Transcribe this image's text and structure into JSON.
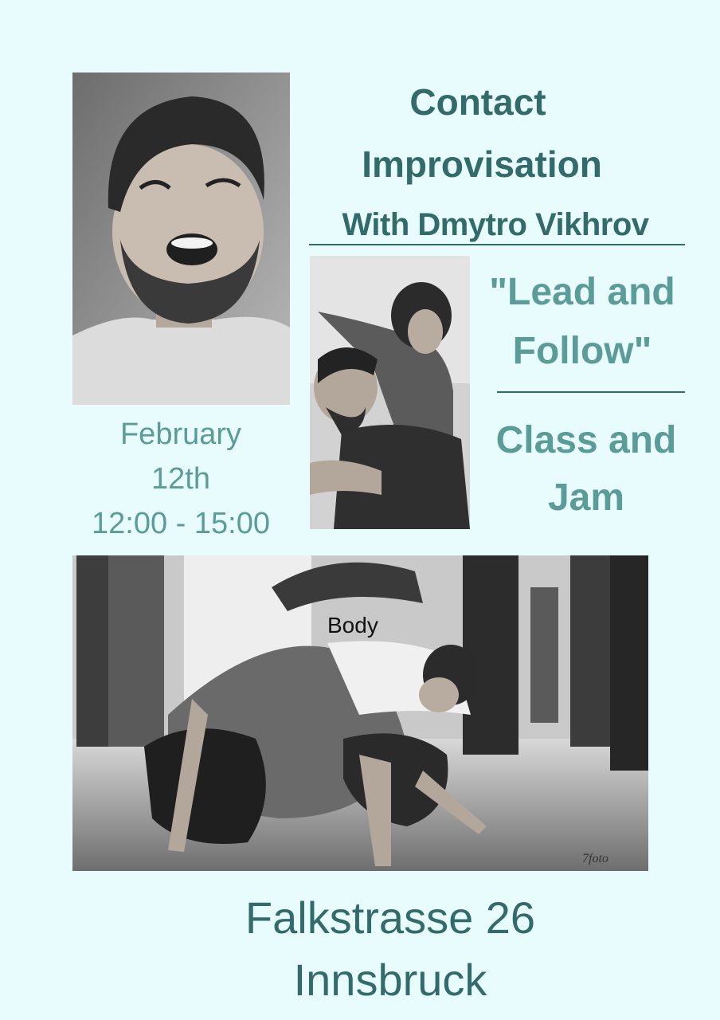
{
  "title_line1": "Contact",
  "title_line2": "Improvisation",
  "with_line": "With Dmytro Vikhrov",
  "theme_line1": "\"Lead and",
  "theme_line2": "Follow\"",
  "format_line1": "Class and",
  "format_line2": "Jam",
  "date_line1": "February",
  "date_line2": "12th",
  "time": "12:00 - 15:00",
  "photo_caption": "Body",
  "watermark": "7foto",
  "address_line1": "Falkstrasse 26",
  "address_line2": "Innsbruck",
  "colors": {
    "background": "#e8fcfd",
    "title_dark_teal": "#336b6a",
    "text_light_teal": "#5c9c98"
  }
}
